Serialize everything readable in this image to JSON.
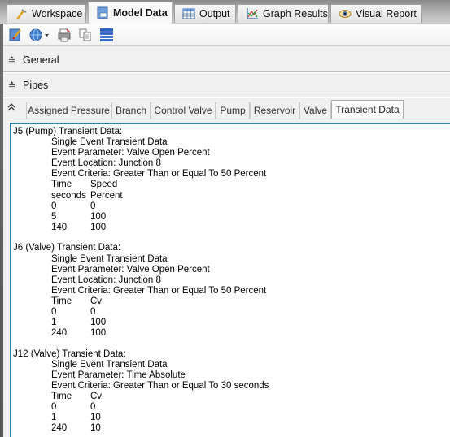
{
  "main_tabs": [
    {
      "label": "Workspace",
      "icon": "workspace-icon",
      "active": false
    },
    {
      "label": "Model Data",
      "icon": "model-data-icon",
      "active": true
    },
    {
      "label": "Output",
      "icon": "output-table-icon",
      "active": false
    },
    {
      "label": "Graph Results",
      "icon": "graph-icon",
      "active": false
    },
    {
      "label": "Visual Report",
      "icon": "eye-icon",
      "active": false
    }
  ],
  "toolbar": {
    "buttons": [
      {
        "name": "edit-notebook-icon"
      },
      {
        "name": "globe-dropdown-icon"
      },
      {
        "name": "print-icon"
      },
      {
        "name": "copy-icon"
      },
      {
        "name": "list-view-icon"
      }
    ]
  },
  "sections": {
    "general": "General",
    "pipes": "Pipes"
  },
  "sub_tabs": [
    {
      "label": "Assigned Pressure",
      "active": false
    },
    {
      "label": "Branch",
      "active": false
    },
    {
      "label": "Control Valve",
      "active": false
    },
    {
      "label": "Pump",
      "active": false
    },
    {
      "label": "Reservoir",
      "active": false
    },
    {
      "label": "Valve",
      "active": false
    },
    {
      "label": "Transient Data",
      "active": true
    }
  ],
  "transient_blocks": [
    {
      "title": "J5 (Pump) Transient Data:",
      "lines": [
        "Single Event Transient Data",
        "Event Parameter: Valve Open Percent",
        "Event Location: Junction 8",
        "Event Criteria: Greater Than or Equal To 50 Percent"
      ],
      "table": [
        [
          "Time",
          "Speed"
        ],
        [
          "seconds",
          "Percent"
        ],
        [
          "0",
          "0"
        ],
        [
          "5",
          "100"
        ],
        [
          "140",
          "100"
        ]
      ]
    },
    {
      "title": "J6 (Valve) Transient Data:",
      "lines": [
        "Single Event Transient Data",
        "Event Parameter: Valve Open Percent",
        "Event Location: Junction 8",
        "Event Criteria: Greater Than or Equal To 50 Percent"
      ],
      "table": [
        [
          "Time",
          "Cv"
        ],
        [
          "0",
          "0"
        ],
        [
          "1",
          "100"
        ],
        [
          "240",
          "100"
        ]
      ]
    },
    {
      "title": "J12 (Valve) Transient Data:",
      "lines": [
        "Single Event Transient Data",
        "Event Parameter: Time Absolute",
        "Event Criteria: Greater Than or Equal To 30 seconds"
      ],
      "table": [
        [
          "Time",
          "Cv"
        ],
        [
          "0",
          "0"
        ],
        [
          "1",
          "10"
        ],
        [
          "240",
          "10"
        ]
      ]
    }
  ],
  "colors": {
    "content_border": "#2e83ad"
  }
}
